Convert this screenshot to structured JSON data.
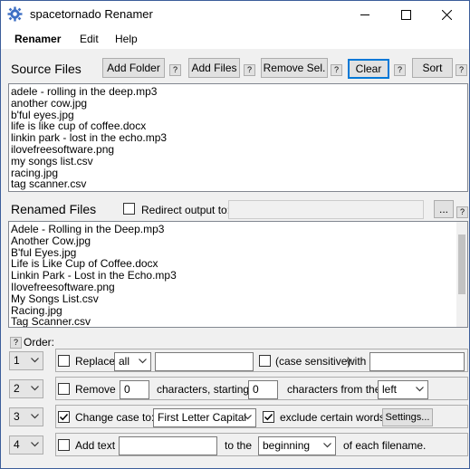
{
  "window": {
    "title": "spacetornado Renamer"
  },
  "menu": [
    "Renamer",
    "Edit",
    "Help"
  ],
  "source": {
    "label": "Source Files",
    "buttons": {
      "add_folder": "Add Folder",
      "add_files": "Add Files",
      "remove_sel": "Remove Sel.",
      "clear": "Clear",
      "sort": "Sort"
    },
    "files": [
      "adele - rolling in the deep.mp3",
      "another cow.jpg",
      "b'ful eyes.jpg",
      "life is like cup of coffee.docx",
      "linkin park - lost in the echo.mp3",
      "ilovefreesoftware.png",
      "my songs list.csv",
      "racing.jpg",
      "tag scanner.csv"
    ]
  },
  "renamed": {
    "label": "Renamed Files",
    "redirect_label": "Redirect output to:",
    "browse": "...",
    "files": [
      "Adele - Rolling in the Deep.mp3",
      "Another Cow.jpg",
      "B'ful Eyes.jpg",
      "Life is Like Cup of Coffee.docx",
      "Linkin Park - Lost in the Echo.mp3",
      "Ilovefreesoftware.png",
      "My Songs List.csv",
      "Racing.jpg",
      "Tag Scanner.csv"
    ]
  },
  "help_mark": "?",
  "order_label": "Order:",
  "rules": {
    "replace": {
      "order": "1",
      "label": "Replace",
      "scope": "all",
      "case_label": "(case sensitive)",
      "with_label": "with"
    },
    "remove": {
      "order": "2",
      "label": "Remove",
      "count": "0",
      "mid_label": "characters, starting",
      "start": "0",
      "from_label": "characters from the",
      "side": "left"
    },
    "change_case": {
      "order": "3",
      "label": "Change case to:",
      "mode": "First Letter Capital",
      "exclude_label": "exclude certain words.",
      "settings": "Settings..."
    },
    "add_text": {
      "order": "4",
      "label": "Add text",
      "to_label": "to the",
      "position": "beginning",
      "suffix_label": "of each filename."
    }
  },
  "colors": {
    "accent": "#0078d7",
    "window_bg": "#f0f0f0"
  }
}
